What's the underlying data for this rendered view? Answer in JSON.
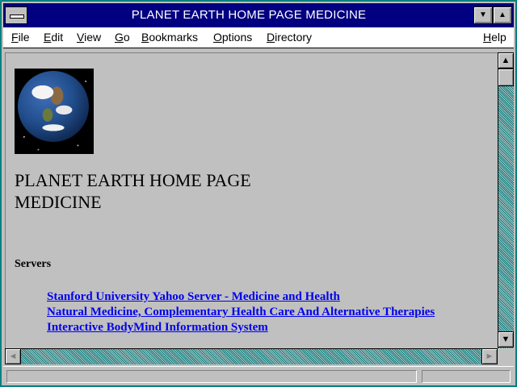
{
  "window": {
    "title": "PLANET EARTH HOME PAGE MEDICINE",
    "controls": {
      "minimize_glyph": "▼",
      "maximize_glyph": "▲"
    }
  },
  "menubar": {
    "items": [
      {
        "label": "File",
        "accel": "F",
        "rest": "ile"
      },
      {
        "label": "Edit",
        "accel": "E",
        "rest": "dit"
      },
      {
        "label": "View",
        "accel": "V",
        "rest": "iew"
      },
      {
        "label": "Go",
        "accel": "G",
        "rest": "o"
      },
      {
        "label": "Bookmarks",
        "accel": "B",
        "rest": "ookmarks"
      },
      {
        "label": "Options",
        "accel": "O",
        "rest": "ptions"
      },
      {
        "label": "Directory",
        "accel": "D",
        "rest": "irectory"
      },
      {
        "label": "Help",
        "accel": "H",
        "rest": "elp"
      }
    ]
  },
  "page": {
    "heading_line1": "PLANET EARTH HOME PAGE",
    "heading_line2": "MEDICINE",
    "section_title": "Servers",
    "links": [
      "Stanford University Yahoo Server - Medicine and Health",
      "Natural Medicine, Complementary Health Care And Alternative Therapies",
      "Interactive BodyMind Information System"
    ]
  },
  "scrollbars": {
    "up_glyph": "▲",
    "down_glyph": "▼",
    "left_glyph": "◄",
    "right_glyph": "►"
  },
  "colors": {
    "titlebar": "#000080",
    "link": "#0000ee",
    "frame": "#008080",
    "background": "#c0c0c0"
  },
  "icons": [
    "system-menu-icon",
    "minimize-icon",
    "maximize-icon",
    "earth-globe-image",
    "scroll-up-icon",
    "scroll-down-icon",
    "scroll-left-icon",
    "scroll-right-icon"
  ]
}
